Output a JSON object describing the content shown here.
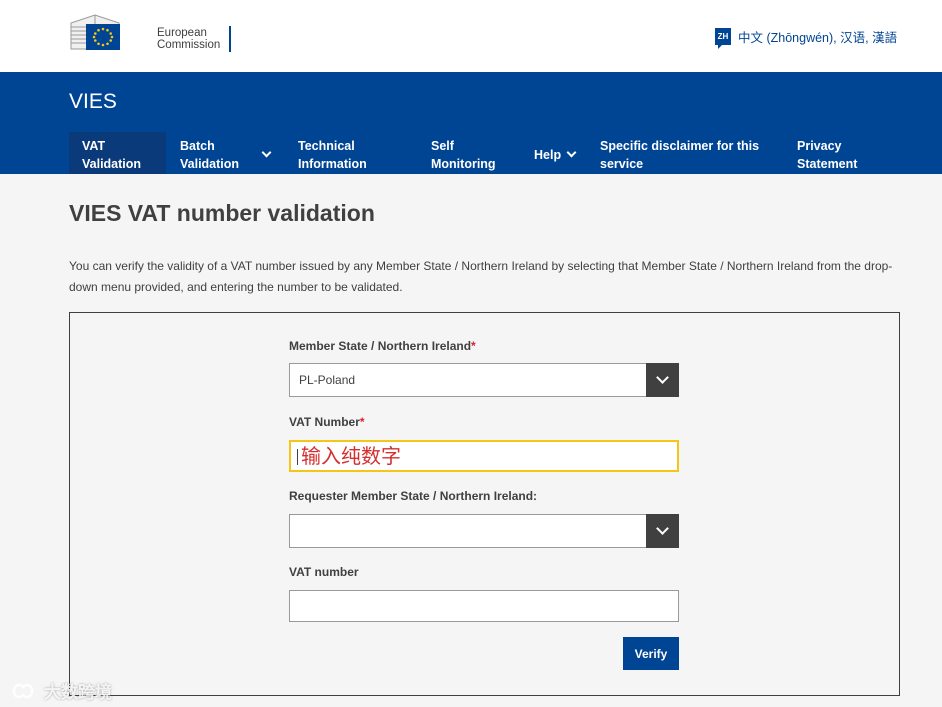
{
  "brand": {
    "line1": "European",
    "line2": "Commission",
    "colors": {
      "primary": "#004494",
      "accent": "#f5c518"
    }
  },
  "language": {
    "badge": "ZH",
    "label": "中文 (Zhōngwén), 汉语, 漢語"
  },
  "site": {
    "title": "VIES"
  },
  "nav": [
    {
      "line1": "VAT",
      "line2": "Validation",
      "active": true
    },
    {
      "line1": "Batch",
      "line2": "Validation",
      "dropdown": true
    },
    {
      "line1": "Technical",
      "line2": "Information"
    },
    {
      "line1": "Self",
      "line2": "Monitoring"
    },
    {
      "line1": "Help",
      "line2": "",
      "dropdown": true
    },
    {
      "line1": "Specific disclaimer for this",
      "line2": "service"
    },
    {
      "line1": "Privacy",
      "line2": "Statement"
    }
  ],
  "main": {
    "title": "VIES VAT number validation",
    "intro": "You can verify the validity of a VAT number issued by any Member State / Northern Ireland by selecting that Member State / Northern Ireland from the drop-down menu provided, and entering the number to be validated."
  },
  "form": {
    "member_state_label": "Member State / Northern Ireland",
    "required_mark": "*",
    "member_state_value": "PL-Poland",
    "vat_number_label": "VAT Number",
    "vat_number_ime_text": "输入纯数字",
    "requester_state_label": "Requester Member State / Northern Ireland:",
    "requester_state_value": "",
    "requester_vat_label": "VAT number",
    "requester_vat_value": "",
    "verify_label": "Verify"
  },
  "watermark": {
    "text": "大数跨境"
  }
}
